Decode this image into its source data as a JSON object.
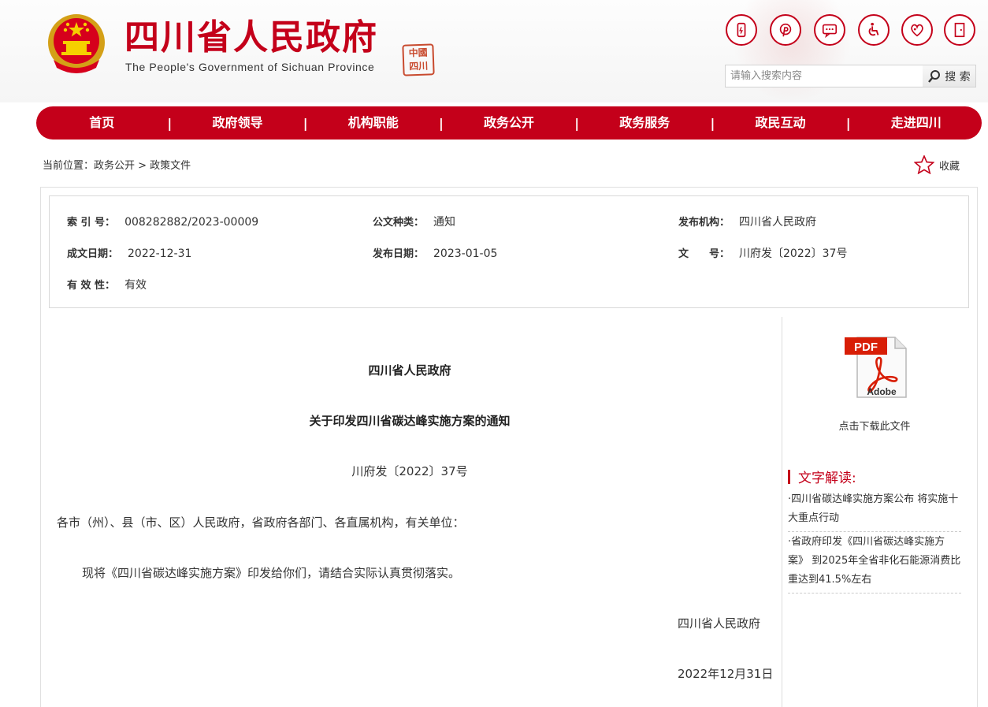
{
  "header": {
    "site_title": "四川省人民政府",
    "site_subtitle": "The People's Government of Sichuan Province",
    "seal_text": "中國四川",
    "tool_icons": [
      "mobile-icon",
      "pinterest-icon",
      "message-icon",
      "accessibility-icon",
      "care-icon",
      "exit-icon"
    ],
    "search_placeholder": "请输入搜索内容",
    "search_label": "搜 索"
  },
  "nav": {
    "items": [
      "首页",
      "政府领导",
      "机构职能",
      "政务公开",
      "政务服务",
      "政民互动",
      "走进四川"
    ],
    "separator": "|"
  },
  "breadcrumb": {
    "text": "当前位置：政务公开 > 政策文件",
    "favorite": "收藏"
  },
  "meta": {
    "index_label": "索 引 号：",
    "index_value": "008282882/2023-00009",
    "type_label": "公文种类：",
    "type_value": "通知",
    "issuer_label": "发布机构：",
    "issuer_value": "四川省人民政府",
    "date_label": "成文日期：",
    "date_value": "2022-12-31",
    "pub_label": "发布日期：",
    "pub_value": "2023-01-05",
    "docno_label": "文　　号：",
    "docno_value": "川府发〔2022〕37号",
    "valid_label": "有 效 性：",
    "valid_value": "有效"
  },
  "article": {
    "org": "四川省人民政府",
    "title": "关于印发四川省碳达峰实施方案的通知",
    "doc_no": "川府发〔2022〕37号",
    "salutation": "各市（州）、县（市、区）人民政府，省政府各部门、各直属机构，有关单位：",
    "body": "现将《四川省碳达峰实施方案》印发给你们，请结合实际认真贯彻落实。",
    "signature": "四川省人民政府",
    "sign_date": "2022年12月31日"
  },
  "sidebar": {
    "pdf_top": "PDF",
    "pdf_bottom": "Adobe",
    "download": "点击下载此文件",
    "interp_title": "文字解读:",
    "interp_items": [
      "·四川省碳达峰实施方案公布 将实施十大重点行动",
      "·省政府印发《四川省碳达峰实施方案》 到2025年全省非化石能源消费比重达到41.5%左右"
    ]
  },
  "colors": {
    "brand_red": "#c4001a"
  }
}
